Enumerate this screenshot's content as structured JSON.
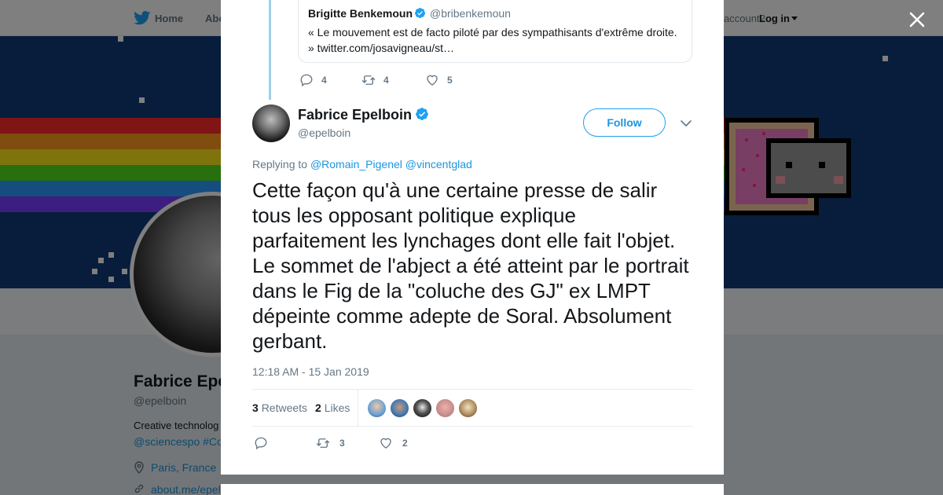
{
  "topnav": {
    "home_label": "Home",
    "about_label": "Abo",
    "account_prompt": "account?",
    "login_label": "Log in"
  },
  "profile": {
    "name": "Fabrice Epe",
    "handle": "@epelboin",
    "bio_line1": "Creative technolog",
    "bio_line2": "@sciencespo #Co",
    "location": "Paris, France",
    "link": "about.me/epel"
  },
  "quoted_tweet": {
    "author_name": "Brigitte Benkemoun",
    "author_handle": "@bribenkemoun",
    "text": "« Le mouvement est de facto piloté par des sympathisants d'extrême droite. » twitter.com/josavigneau/st…",
    "reply_count": "4",
    "retweet_count": "4",
    "like_count": "5"
  },
  "tweet": {
    "author_name": "Fabrice Epelboin",
    "author_handle": "@epelboin",
    "follow_label": "Follow",
    "replying_prefix": "Replying to",
    "replying_to": [
      "@Romain_Pigenel",
      "@vincentglad"
    ],
    "text": "Cette façon qu'à une certaine presse de salir tous les opposant politique explique parfaitement les lynchages dont elle fait l'objet. Le sommet de l'abject a été atteint par le portrait dans le Fig de la \"coluche des GJ\" ex LMPT dépeinte comme adepte de Soral. Absolument gerbant.",
    "timestamp": "12:18 AM - 15 Jan 2019",
    "retweets_count": "3",
    "retweets_label": "Retweets",
    "likes_count": "2",
    "likes_label": "Likes",
    "actions": {
      "reply_count": "",
      "retweet_count": "3",
      "like_count": "2"
    }
  },
  "colors": {
    "accent": "#1da1f2",
    "link": "#1b95e0",
    "verified": "#1da1f2",
    "muted": "#657786",
    "banner_bg": "#0e3b76"
  },
  "icons": [
    "twitter-bird-icon",
    "close-icon",
    "verified-badge-icon",
    "chevron-down-icon",
    "reply-icon",
    "retweet-icon",
    "heart-icon",
    "location-pin-icon",
    "link-icon"
  ]
}
